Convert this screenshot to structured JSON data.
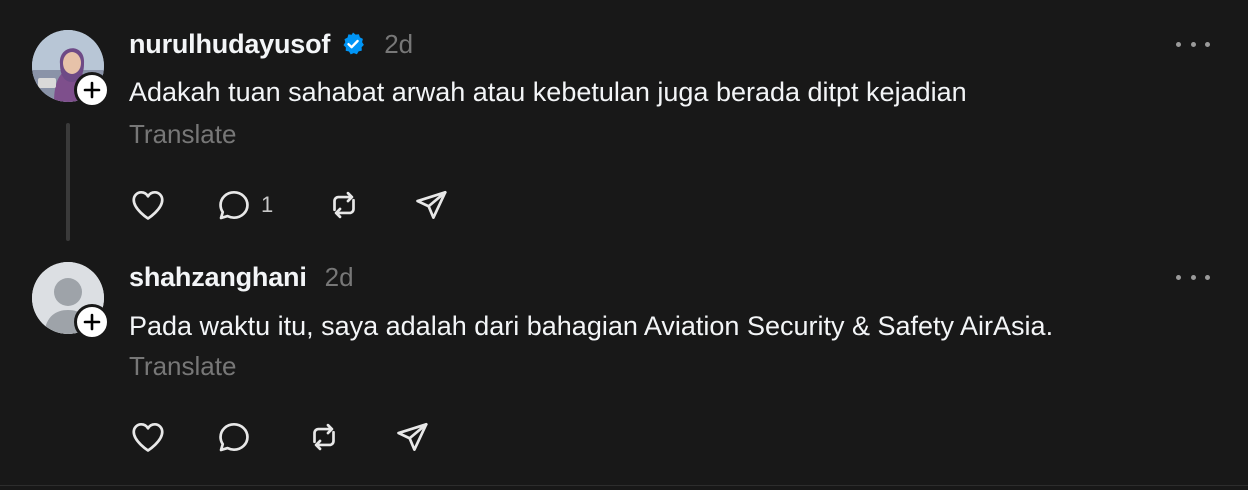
{
  "posts": [
    {
      "username": "nurulhudayusof",
      "verified": true,
      "timestamp": "2d",
      "text": "Adakah tuan sahabat arwah atau kebetulan juga berada ditpt kejadian",
      "translate_label": "Translate",
      "reply_count": "1",
      "avatar": "profile-photo",
      "icons": {
        "like": "heart-icon",
        "reply": "comment-icon",
        "repost": "repost-icon",
        "share": "send-icon",
        "follow": "plus-icon",
        "more": "more-dots-icon"
      }
    },
    {
      "username": "shahzanghani",
      "verified": false,
      "timestamp": "2d",
      "text": "Pada waktu itu, saya adalah dari bahagian Aviation Security & Safety AirAsia.",
      "translate_label": "Translate",
      "avatar": "default-person-icon",
      "icons": {
        "like": "heart-icon",
        "reply": "comment-icon",
        "repost": "repost-icon",
        "share": "send-icon",
        "follow": "plus-icon",
        "more": "more-dots-icon"
      }
    }
  ],
  "colors": {
    "background": "#181818",
    "primary_text": "#f3f5f7",
    "secondary_text": "#777777",
    "verified_blue": "#0095f6",
    "thread_line": "#3a3a3a"
  }
}
